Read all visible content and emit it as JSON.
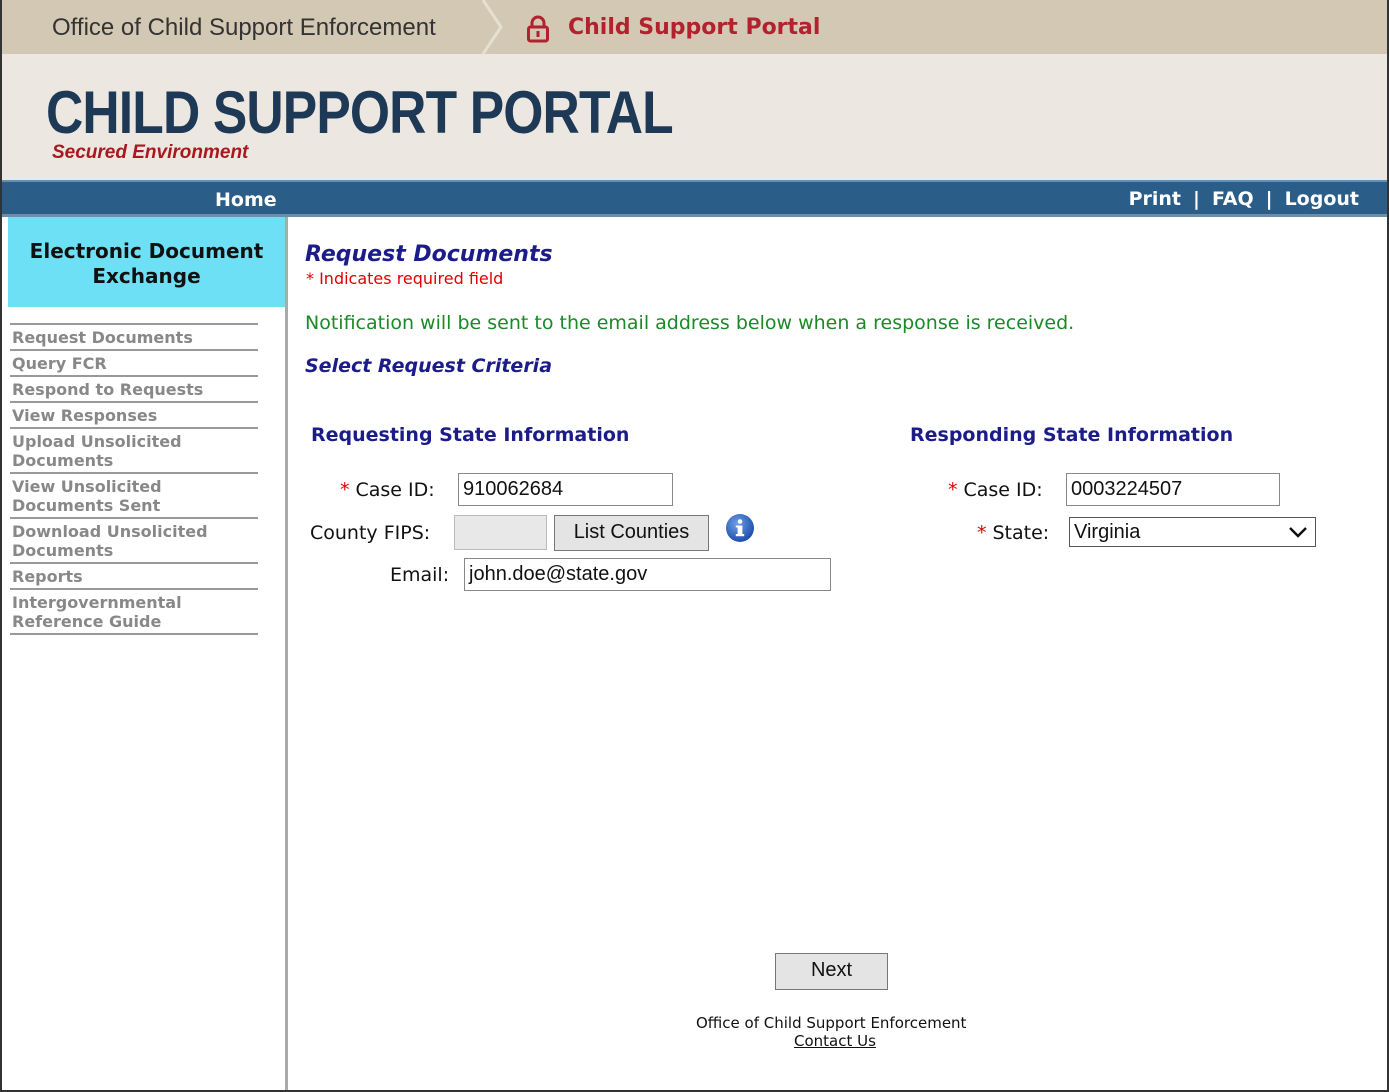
{
  "topbar": {
    "agency": "Office of Child Support Enforcement",
    "portal": "Child Support Portal"
  },
  "banner": {
    "title": "CHILD SUPPORT PORTAL",
    "subtitle": "Secured Environment"
  },
  "navbar": {
    "home": "Home",
    "print": "Print",
    "faq": "FAQ",
    "logout": "Logout",
    "separator": "|"
  },
  "sidebar": {
    "heading_line1": "Electronic Document",
    "heading_line2": "Exchange",
    "items": [
      {
        "label": "Request Documents"
      },
      {
        "label": "Query FCR"
      },
      {
        "label": "Respond to Requests"
      },
      {
        "label": "View Responses"
      },
      {
        "label": "Upload Unsolicited Documents"
      },
      {
        "label": "View Unsolicited Documents Sent"
      },
      {
        "label": "Download Unsolicited Documents"
      },
      {
        "label": "Reports"
      },
      {
        "label": "Intergovernmental Reference Guide"
      }
    ]
  },
  "main": {
    "title": "Request Documents",
    "required_note": "* Indicates required field",
    "notice": "Notification will be sent to the email address below when a response is received.",
    "criteria_heading": "Select Request Criteria",
    "requesting": {
      "heading": "Requesting State Information",
      "case_id_label": "Case ID:",
      "case_id_value": "910062684",
      "county_fips_label": "County FIPS:",
      "county_fips_value": "",
      "list_counties_button": "List Counties",
      "email_label": "Email:",
      "email_value": "john.doe@state.gov"
    },
    "responding": {
      "heading": "Responding State Information",
      "case_id_label": "Case ID:",
      "case_id_value": "0003224507",
      "state_label": "State:",
      "state_value": "Virginia"
    },
    "required_star": "*",
    "next_button": "Next",
    "footer_agency": "Office of Child Support Enforcement",
    "footer_contact": "Contact Us"
  },
  "colors": {
    "nav_blue": "#2a5e88",
    "heading_blue": "#1b1c8a",
    "required_red": "#e00000",
    "notice_green": "#1a8a26",
    "sidebar_head": "#6ee0f5"
  }
}
